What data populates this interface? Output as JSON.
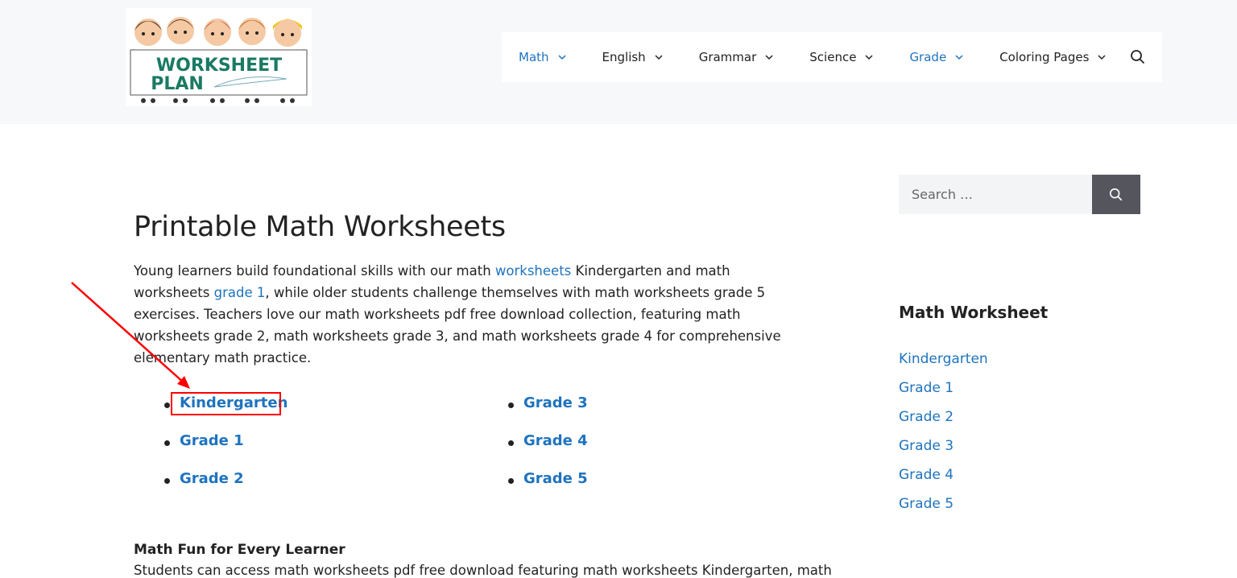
{
  "header": {
    "logo_text_line1": "WORKSHEET",
    "logo_text_line2": "PLAN",
    "nav": [
      {
        "label": "Math",
        "active": true
      },
      {
        "label": "English",
        "active": false
      },
      {
        "label": "Grammar",
        "active": false
      },
      {
        "label": "Science",
        "active": false
      },
      {
        "label": "Grade",
        "active": true
      },
      {
        "label": "Coloring Pages",
        "active": false
      }
    ],
    "search_icon": "search-icon",
    "dropdown_icon": "chevron-down-icon"
  },
  "main": {
    "title": "Printable Math Worksheets",
    "intro": {
      "p1": "Young learners build foundational skills with our math ",
      "link1": "worksheets",
      "p2": " Kindergarten and math worksheets ",
      "link2": "grade 1",
      "p3": ", while older students challenge themselves with math worksheets grade 5 exercises. Teachers love our math worksheets pdf free download collection, featuring math worksheets grade 2, math worksheets grade 3, and math worksheets grade 4 for comprehensive elementary math practice."
    },
    "grades_left": [
      "Kindergarten",
      "Grade 1",
      "Grade 2"
    ],
    "grades_right": [
      "Grade 3",
      "Grade 4",
      "Grade 5"
    ],
    "section_heading": "Math Fun for Every Learner",
    "section_text": "Students can access math worksheets pdf free download featuring math worksheets Kindergarten, math"
  },
  "sidebar": {
    "search_placeholder": "Search …",
    "widget_title": "Math Worksheet",
    "links": [
      "Kindergarten",
      "Grade 1",
      "Grade 2",
      "Grade 3",
      "Grade 4",
      "Grade 5"
    ]
  },
  "colors": {
    "link": "#1e73be",
    "header_bg": "#f7f8f9",
    "annotation": "#ff0000",
    "search_button": "#55555e"
  }
}
